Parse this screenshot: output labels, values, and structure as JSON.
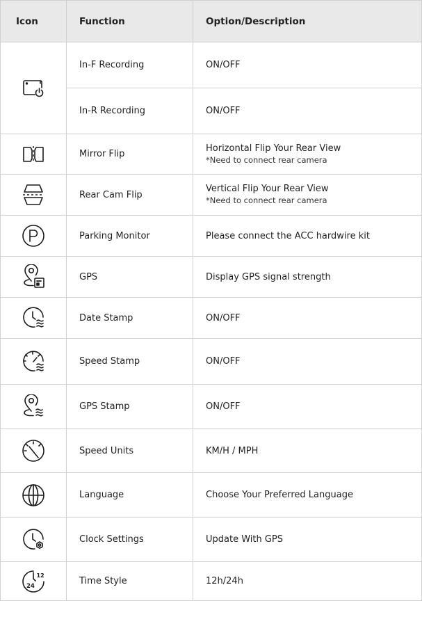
{
  "headers": {
    "icon": "Icon",
    "function": "Function",
    "description": "Option/Description"
  },
  "rows": [
    {
      "icon": "recording-power-icon",
      "function": "In-F Recording",
      "description": "ON/OFF"
    },
    {
      "function": "In-R Recording",
      "description": "ON/OFF"
    },
    {
      "icon": "mirror-flip-icon",
      "function": "Mirror Flip",
      "description": "Horizontal Flip Your Rear View",
      "note": "*Need to connect rear camera"
    },
    {
      "icon": "rear-cam-flip-icon",
      "function": "Rear Cam Flip",
      "description": "Vertical Flip Your Rear View",
      "note": "*Need to connect rear camera"
    },
    {
      "icon": "parking-icon",
      "function": "Parking Monitor",
      "description": "Please connect the ACC hardwire kit"
    },
    {
      "icon": "gps-signal-icon",
      "function": "GPS",
      "description": "Display GPS signal strength"
    },
    {
      "icon": "date-stamp-icon",
      "function": "Date Stamp",
      "description": "ON/OFF"
    },
    {
      "icon": "speed-stamp-icon",
      "function": "Speed Stamp",
      "description": "ON/OFF"
    },
    {
      "icon": "gps-stamp-icon",
      "function": "GPS Stamp",
      "description": "ON/OFF"
    },
    {
      "icon": "speedometer-icon",
      "function": "Speed Units",
      "description": "KM/H / MPH"
    },
    {
      "icon": "globe-icon",
      "function": "Language",
      "description": "Choose Your Preferred Language"
    },
    {
      "icon": "clock-settings-icon",
      "function": "Clock Settings",
      "description": "Update With GPS"
    },
    {
      "icon": "time-style-icon",
      "function": "Time Style",
      "description": "12h/24h",
      "icon_text_a": "24",
      "icon_text_b": "12"
    }
  ]
}
